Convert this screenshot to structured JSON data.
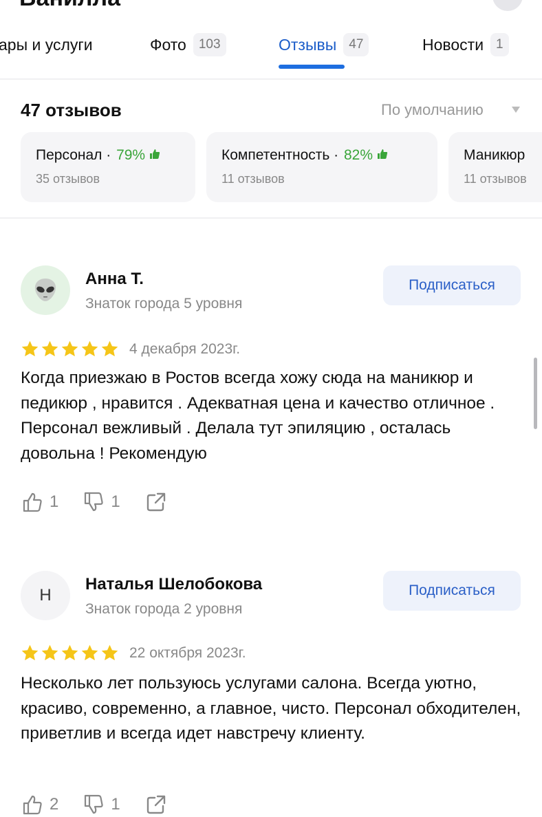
{
  "header": {
    "title_partial": "Ванилла"
  },
  "tabs": [
    {
      "label": "ары и услуги",
      "count": ""
    },
    {
      "label": "Фото",
      "count": "103"
    },
    {
      "label": "Отзывы",
      "count": "47"
    },
    {
      "label": "Новости",
      "count": "1"
    }
  ],
  "reviews_header": {
    "title": "47 отзывов",
    "sort_label": "По умолчанию"
  },
  "aspects": [
    {
      "name": "Персонал",
      "sep": " · ",
      "percent": "79%",
      "sub": "35 отзывов"
    },
    {
      "name": "Компетентность",
      "sep": " · ",
      "percent": "82%",
      "sub": "11 отзывов"
    },
    {
      "name": "Маникюр",
      "sep": "",
      "percent": "",
      "sub": "11 отзывов"
    }
  ],
  "reviews": [
    {
      "author": "Анна Т.",
      "level": "Знаток города 5 уровня",
      "avatar": "alien-emoji",
      "subscribe_label": "Подписаться",
      "rating": 5,
      "date": "4 декабря 2023г.",
      "text": "Когда приезжаю в Ростов всегда хожу сюда на маникюр и педикюр , нравится . Адекватная цена и качество отличное . Персонал вежливый . Делала тут эпиляцию , осталась довольна ! Рекомендую",
      "likes": "1",
      "dislikes": "1"
    },
    {
      "author": "Наталья Шелобокова",
      "level": "Знаток города 2 уровня",
      "avatar": "Н",
      "subscribe_label": "Подписаться",
      "rating": 5,
      "date": "22 октября 2023г.",
      "text": "Несколько лет пользуюсь услугами салона. Всегда уютно, красиво, современно, а главное, чисто. Персонал обходителен, приветлив и всегда идет навстречу клиенту.",
      "likes": "2",
      "dislikes": "1"
    }
  ],
  "colors": {
    "accent": "#1d6ee0",
    "star": "#f5c518",
    "positive": "#3aa53a"
  }
}
